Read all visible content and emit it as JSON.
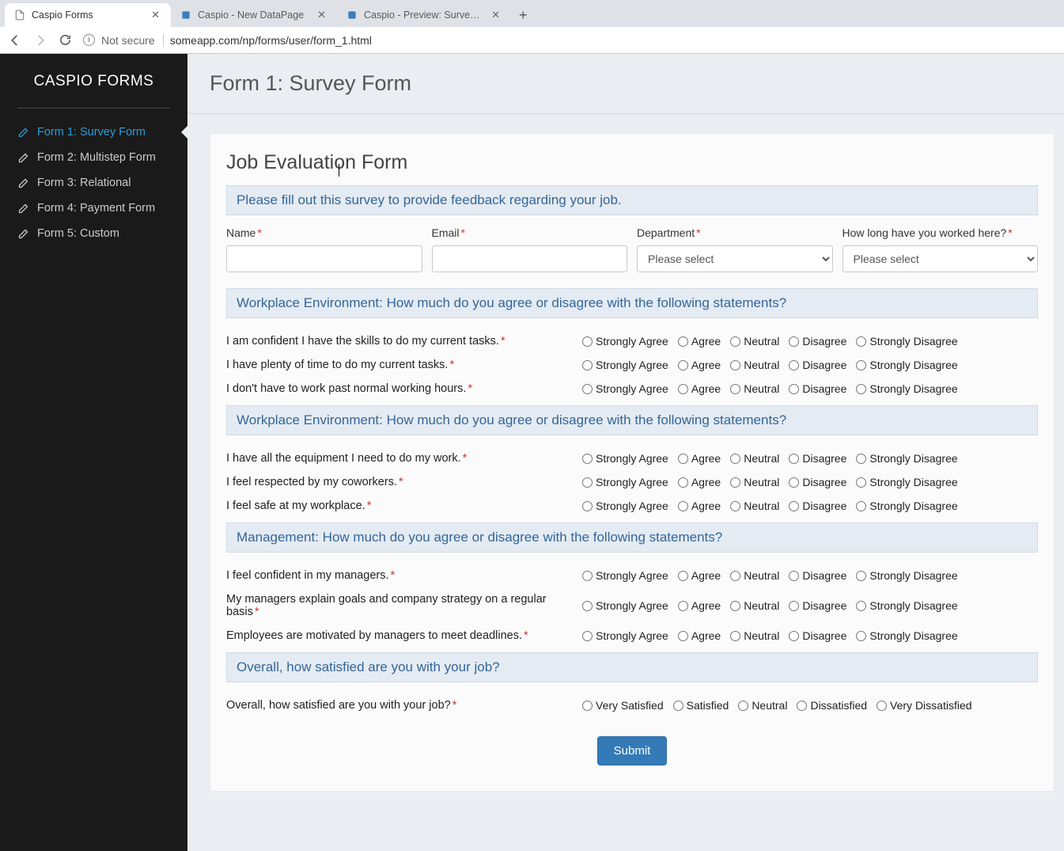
{
  "browser": {
    "tabs": [
      {
        "label": "Caspio Forms",
        "active": true,
        "icon": "file"
      },
      {
        "label": "Caspio - New DataPage",
        "active": false,
        "icon": "app"
      },
      {
        "label": "Caspio - Preview: Survey Form",
        "active": false,
        "icon": "app"
      }
    ],
    "secure_text": "Not secure",
    "url": "someapp.com/np/forms/user/form_1.html"
  },
  "sidebar": {
    "brand": "CASPIO FORMS",
    "items": [
      {
        "label": "Form 1: Survey Form",
        "active": true
      },
      {
        "label": "Form 2: Multistep Form",
        "active": false
      },
      {
        "label": "Form 3: Relational",
        "active": false
      },
      {
        "label": "Form 4: Payment Form",
        "active": false
      },
      {
        "label": "Form 5: Custom",
        "active": false
      }
    ]
  },
  "page": {
    "title": "Form 1: Survey Form",
    "form_title": "Job Evaluation Form",
    "intro": "Please fill out this survey to provide feedback regarding your job.",
    "fields": {
      "name_label": "Name",
      "email_label": "Email",
      "department_label": "Department",
      "tenure_label": "How long have you worked here?",
      "select_placeholder": "Please select"
    },
    "scale_options": [
      "Strongly Agree",
      "Agree",
      "Neutral",
      "Disagree",
      "Strongly Disagree"
    ],
    "satisfaction_options": [
      "Very Satisfied",
      "Satisfied",
      "Neutral",
      "Dissatisfied",
      "Very Dissatisfied"
    ],
    "sections": [
      {
        "heading": "Workplace Environment: How much do you agree or disagree with the following statements?",
        "questions": [
          "I am confident I have the skills to do my current tasks.",
          "I have plenty of time to do my current tasks.",
          "I don't have to work past normal working hours."
        ]
      },
      {
        "heading": "Workplace Environment: How much do you agree or disagree with the following statements?",
        "questions": [
          "I have all the equipment I need to do my work.",
          "I feel respected by my coworkers.",
          "I feel safe at my workplace."
        ]
      },
      {
        "heading": "Management: How much do you agree or disagree with the following statements?",
        "questions": [
          "I feel confident in my managers.",
          "My managers explain goals and company strategy on a regular basis",
          "Employees are motivated by managers to meet deadlines."
        ]
      }
    ],
    "overall_heading": "Overall, how satisfied are you with your job?",
    "overall_question": "Overall, how satisfied are you with your job?",
    "submit_label": "Submit"
  }
}
